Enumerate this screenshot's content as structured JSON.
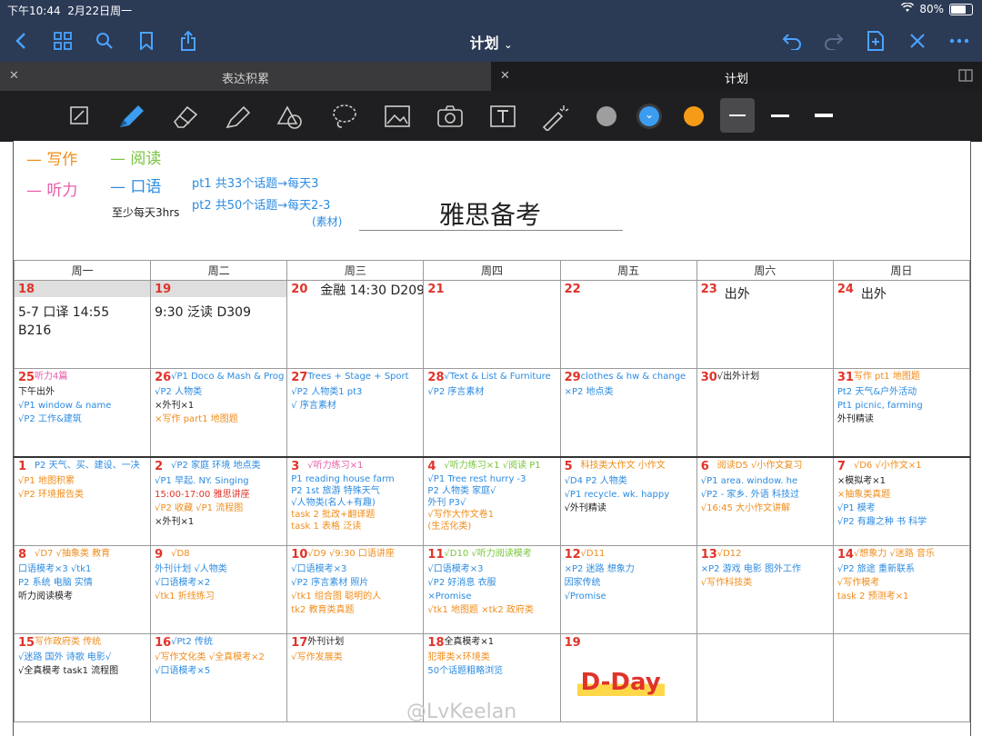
{
  "status": {
    "time": "下午10:44",
    "date": "2月22日周一",
    "battery": "80%",
    "battery_level": 0.8
  },
  "nav": {
    "title": "计划"
  },
  "tabs": [
    {
      "label": "表达积累"
    },
    {
      "label": "计划"
    }
  ],
  "colors": {
    "blue": "#2c8be0",
    "orange": "#f08c1a",
    "red": "#e0332a",
    "green": "#78c43a",
    "pink": "#e85aa8",
    "gray_dot": "#9e9e9e",
    "blue_dot": "#3b9cf0",
    "orange_dot": "#f59b17"
  },
  "legend": {
    "writing": "写作",
    "reading": "阅读",
    "listening": "听力",
    "speaking": "口语",
    "pt1": "pt1 共33个话题→每天3",
    "pt2": "pt2 共50个话题→每天2-3",
    "min": "至少每天3hrs",
    "material": "(素材)",
    "title": "雅思备考"
  },
  "weekdays": [
    "周一",
    "周二",
    "周三",
    "周四",
    "周五",
    "周六",
    "周日"
  ],
  "weeks": [
    [
      {
        "date": "18",
        "lines": [
          {
            "t": "5-7 口译 14:55",
            "c": "black"
          },
          {
            "t": "B216",
            "c": "black"
          }
        ]
      },
      {
        "date": "19",
        "lines": [
          {
            "t": "9:30 泛读 D309",
            "c": "black"
          }
        ]
      },
      {
        "date": "20",
        "lines": [
          {
            "t": "金融 14:30 D209",
            "c": "black"
          }
        ]
      },
      {
        "date": "21",
        "lines": []
      },
      {
        "date": "22",
        "lines": []
      },
      {
        "date": "23",
        "lines": [
          {
            "t": "出外",
            "c": "black"
          }
        ]
      },
      {
        "date": "24",
        "lines": [
          {
            "t": "出外",
            "c": "black"
          }
        ]
      }
    ],
    [
      {
        "date": "25",
        "lines": [
          {
            "t": "听力4篇",
            "c": "pink"
          },
          {
            "t": "下午出外",
            "c": "black"
          },
          {
            "t": "√P1 window & name",
            "c": "blue"
          },
          {
            "t": "√P2 工作&建筑",
            "c": "blue"
          }
        ]
      },
      {
        "date": "26",
        "lines": [
          {
            "t": "√P1 Doco & Mash & Prog",
            "c": "blue"
          },
          {
            "t": "√P2 人物类",
            "c": "blue"
          },
          {
            "t": "×外刊×1",
            "c": "black"
          },
          {
            "t": "×写作 part1 地图题",
            "c": "orange"
          }
        ]
      },
      {
        "date": "27",
        "lines": [
          {
            "t": "Trees + Stage + Sport",
            "c": "blue"
          },
          {
            "t": "√P2 人物类1 pt3",
            "c": "blue"
          },
          {
            "t": "√ 序言素材",
            "c": "blue"
          }
        ]
      },
      {
        "date": "28",
        "lines": [
          {
            "t": "√Text & List & Furniture",
            "c": "blue"
          },
          {
            "t": "√P2 序言素材",
            "c": "blue"
          }
        ]
      },
      {
        "date": "29",
        "lines": [
          {
            "t": "clothes & hw & change",
            "c": "blue"
          },
          {
            "t": "×P2 地点类",
            "c": "blue"
          }
        ]
      },
      {
        "date": "30",
        "lines": [
          {
            "t": "√出外计划",
            "c": "black"
          }
        ]
      },
      {
        "date": "31",
        "lines": [
          {
            "t": "写作 pt1 地图题",
            "c": "orange"
          },
          {
            "t": "Pt2 天气&户外活动",
            "c": "blue"
          },
          {
            "t": "Pt1 picnic, farming",
            "c": "blue"
          },
          {
            "t": "外刊精读",
            "c": "black"
          }
        ]
      }
    ],
    [
      {
        "date": "1",
        "lines": [
          {
            "t": "P2 天气、买、建设、一决",
            "c": "blue"
          },
          {
            "t": "√P1 地图积累",
            "c": "orange"
          },
          {
            "t": "√P2 环境报告类",
            "c": "orange"
          }
        ]
      },
      {
        "date": "2",
        "lines": [
          {
            "t": "√P2 家庭 环境 地点类",
            "c": "blue"
          },
          {
            "t": "√P1 早起. NY. Singing",
            "c": "blue"
          },
          {
            "t": "15:00-17:00 雅思讲座",
            "c": "red"
          },
          {
            "t": "√P2 收藏 √P1 流程图",
            "c": "orange"
          },
          {
            "t": "×外刊×1",
            "c": "black"
          }
        ]
      },
      {
        "date": "3",
        "lines": [
          {
            "t": "√听力练习×1",
            "c": "pink"
          },
          {
            "t": "P1 reading house farm",
            "c": "blue"
          },
          {
            "t": "P2 1st 旅游 特殊天气",
            "c": "blue"
          },
          {
            "t": "√人物类(名人+有趣)",
            "c": "blue"
          },
          {
            "t": "task 2 批改+翻译题",
            "c": "orange"
          },
          {
            "t": "task 1 表格   泛读",
            "c": "orange"
          }
        ]
      },
      {
        "date": "4",
        "lines": [
          {
            "t": "√听力练习×1 √阅读 P1",
            "c": "green"
          },
          {
            "t": "√P1 Tree rest hurry -3",
            "c": "blue"
          },
          {
            "t": "P2 人物类 家庭√",
            "c": "blue"
          },
          {
            "t": "外刊 P3√",
            "c": "blue"
          },
          {
            "t": "√写作大作文卷1",
            "c": "orange"
          },
          {
            "t": "(生活化类)",
            "c": "orange"
          }
        ]
      },
      {
        "date": "5",
        "lines": [
          {
            "t": "科技类大作文 小作文",
            "c": "orange"
          },
          {
            "t": "√D4 P2 人物类",
            "c": "blue"
          },
          {
            "t": "√P1 recycle. wk. happy",
            "c": "blue"
          },
          {
            "t": "√外刊精读",
            "c": "black"
          }
        ]
      },
      {
        "date": "6",
        "lines": [
          {
            "t": "阅读D5 √小作文复习",
            "c": "orange"
          },
          {
            "t": "√P1 area. window. he",
            "c": "blue"
          },
          {
            "t": "√P2 - 家乡. 外语 科技过",
            "c": "blue"
          },
          {
            "t": "√16:45 大小作文讲解",
            "c": "orange"
          }
        ]
      },
      {
        "date": "7",
        "lines": [
          {
            "t": "√D6 √小作文×1",
            "c": "orange"
          },
          {
            "t": "×模拟考×1",
            "c": "black"
          },
          {
            "t": "×抽象类真题",
            "c": "orange"
          },
          {
            "t": "√P1 模考",
            "c": "blue"
          },
          {
            "t": "√P2 有趣之种 书 科学",
            "c": "blue"
          }
        ]
      }
    ],
    [
      {
        "date": "8",
        "lines": [
          {
            "t": "√D7 √抽象类 教育",
            "c": "orange"
          },
          {
            "t": "口语模考×3 √tk1",
            "c": "blue"
          },
          {
            "t": "P2 系统 电脑 实情",
            "c": "blue"
          },
          {
            "t": "听力阅读模考",
            "c": "black"
          }
        ]
      },
      {
        "date": "9",
        "lines": [
          {
            "t": "√D8",
            "c": "orange"
          },
          {
            "t": "外刊计划 √人物类",
            "c": "blue"
          },
          {
            "t": "√口语模考×2",
            "c": "blue"
          },
          {
            "t": "√tk1 折线练习",
            "c": "orange"
          }
        ]
      },
      {
        "date": "10",
        "lines": [
          {
            "t": "√D9 √9:30 口语讲座",
            "c": "orange"
          },
          {
            "t": "√口语模考×3",
            "c": "blue"
          },
          {
            "t": "√P2 序言素材 照片",
            "c": "blue"
          },
          {
            "t": "√tk1 组合图  聪明的人",
            "c": "orange"
          },
          {
            "t": "tk2 教育类真题",
            "c": "orange"
          }
        ]
      },
      {
        "date": "11",
        "lines": [
          {
            "t": "√D10 √听力阅读模考",
            "c": "green"
          },
          {
            "t": "√口语模考×3",
            "c": "blue"
          },
          {
            "t": "√P2 好消息 衣服",
            "c": "blue"
          },
          {
            "t": "×Promise",
            "c": "blue"
          },
          {
            "t": "√tk1 地图题 ×tk2 政府类",
            "c": "orange"
          }
        ]
      },
      {
        "date": "12",
        "lines": [
          {
            "t": "√D11",
            "c": "orange"
          },
          {
            "t": "×P2 迷路 想象力",
            "c": "blue"
          },
          {
            "t": "因家传统",
            "c": "blue"
          },
          {
            "t": "√Promise",
            "c": "blue"
          }
        ]
      },
      {
        "date": "13",
        "lines": [
          {
            "t": "√D12",
            "c": "orange"
          },
          {
            "t": "×P2 游戏 电影 图外工作",
            "c": "blue"
          },
          {
            "t": "√写作科技类",
            "c": "orange"
          }
        ]
      },
      {
        "date": "14",
        "lines": [
          {
            "t": "√想象力 √迷路 音乐",
            "c": "orange"
          },
          {
            "t": "√P2 旅途 重新联系",
            "c": "blue"
          },
          {
            "t": "√写作模考",
            "c": "orange"
          },
          {
            "t": "task 2 预测考×1",
            "c": "orange"
          }
        ]
      }
    ],
    [
      {
        "date": "15",
        "lines": [
          {
            "t": "写作政府类 传统",
            "c": "orange"
          },
          {
            "t": "√迷路 国外 诗歌 电影√",
            "c": "blue"
          },
          {
            "t": "√全真模考 task1 流程图",
            "c": "black"
          }
        ]
      },
      {
        "date": "16",
        "lines": [
          {
            "t": "√Pt2 传统",
            "c": "blue"
          },
          {
            "t": "√写作文化类 √全真模考×2",
            "c": "orange"
          },
          {
            "t": "√口语模考×5",
            "c": "blue"
          }
        ]
      },
      {
        "date": "17",
        "lines": [
          {
            "t": "外刊计划",
            "c": "black"
          },
          {
            "t": "√写作发展类",
            "c": "orange"
          }
        ]
      },
      {
        "date": "18",
        "lines": [
          {
            "t": "全真模考×1",
            "c": "black"
          },
          {
            "t": "犯罪类×环境类",
            "c": "orange"
          },
          {
            "t": "50个话题粗略浏览",
            "c": "blue"
          }
        ]
      },
      {
        "date": "19",
        "lines": [],
        "dday": "D-Day"
      },
      {
        "date": "",
        "lines": []
      },
      {
        "date": "",
        "lines": []
      }
    ]
  ],
  "watermark": "@LvKeelan"
}
